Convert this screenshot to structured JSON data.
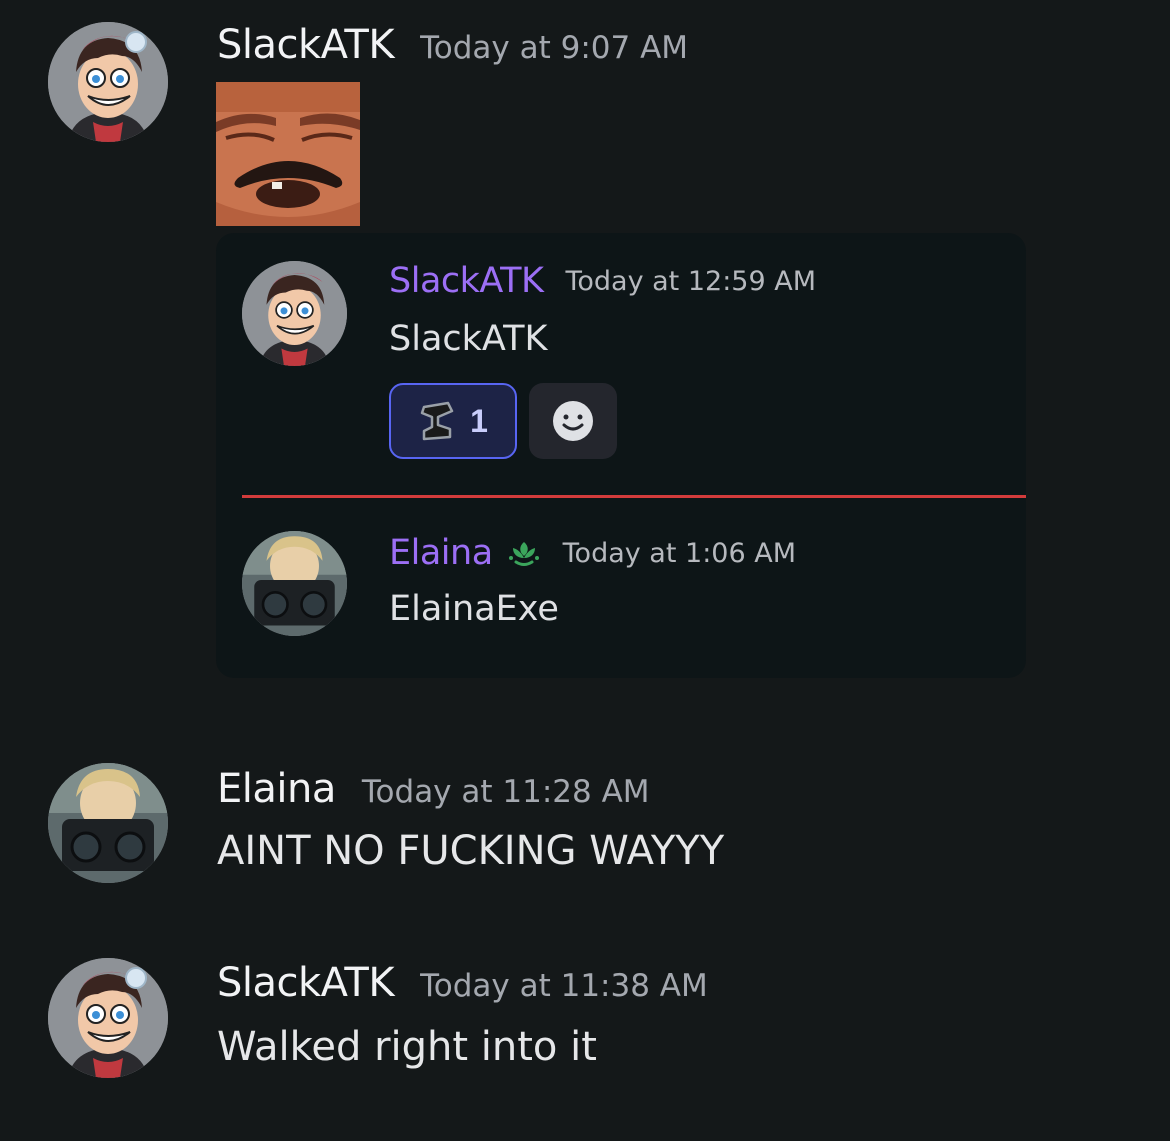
{
  "messages": [
    {
      "username": "SlackATK",
      "timestamp": "Today at 9:07 AM",
      "attachment": {
        "type": "emoji-image",
        "icon": "laughing-man-emoji"
      },
      "embed": {
        "first": {
          "username": "SlackATK",
          "timestamp": "Today at 12:59 AM",
          "text": "SlackATK",
          "reactions": [
            {
              "icon": "anvil-icon",
              "count": "1",
              "active": true
            },
            {
              "icon": "add-reaction-icon"
            }
          ]
        },
        "second": {
          "username": "Elaina",
          "badge_icon": "lotus-badge-icon",
          "timestamp": "Today at 1:06 AM",
          "text": "ElainaExe"
        }
      }
    },
    {
      "username": "Elaina",
      "timestamp": "Today at 11:28 AM",
      "text": "AINT NO FUCKING WAYYY"
    },
    {
      "username": "SlackATK",
      "timestamp": "Today at 11:38 AM",
      "text": "Walked right into it"
    }
  ],
  "colors": {
    "background": "#141819",
    "embed_background": "#0d1517",
    "embed_username": "#9c6ff5",
    "reaction_active_border": "#5865f2",
    "divider": "#d23b3b",
    "badge": "#3ba55c"
  }
}
